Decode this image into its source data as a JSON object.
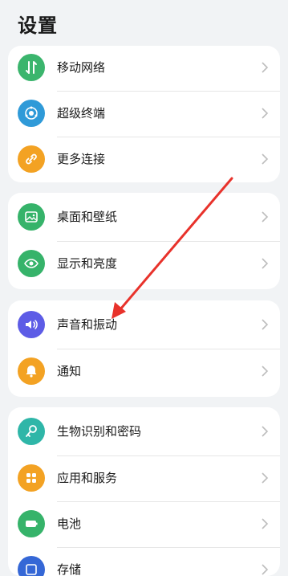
{
  "header": {
    "title": "设置"
  },
  "groups": [
    {
      "items": [
        {
          "label": "移动网络",
          "icon": "mobile-data-icon",
          "color": "#3bb56d"
        },
        {
          "label": "超级终端",
          "icon": "super-device-icon",
          "color": "#2f9ad8"
        },
        {
          "label": "更多连接",
          "icon": "link-icon",
          "color": "#f3a223"
        }
      ]
    },
    {
      "items": [
        {
          "label": "桌面和壁纸",
          "icon": "wallpaper-icon",
          "color": "#36b36a"
        },
        {
          "label": "显示和亮度",
          "icon": "eye-icon",
          "color": "#36b36a"
        }
      ]
    },
    {
      "items": [
        {
          "label": "声音和振动",
          "icon": "speaker-icon",
          "color": "#5d5ce6"
        },
        {
          "label": "通知",
          "icon": "bell-icon",
          "color": "#f3a223"
        }
      ]
    },
    {
      "items": [
        {
          "label": "生物识别和密码",
          "icon": "key-icon",
          "color": "#2fb6a8"
        },
        {
          "label": "应用和服务",
          "icon": "apps-grid-icon",
          "color": "#f3a223"
        },
        {
          "label": "电池",
          "icon": "battery-icon",
          "color": "#36b36a"
        },
        {
          "label": "存储",
          "icon": "storage-icon",
          "color": "#3567d6"
        }
      ]
    }
  ],
  "annotation": {
    "arrow_color": "#e8322b"
  }
}
